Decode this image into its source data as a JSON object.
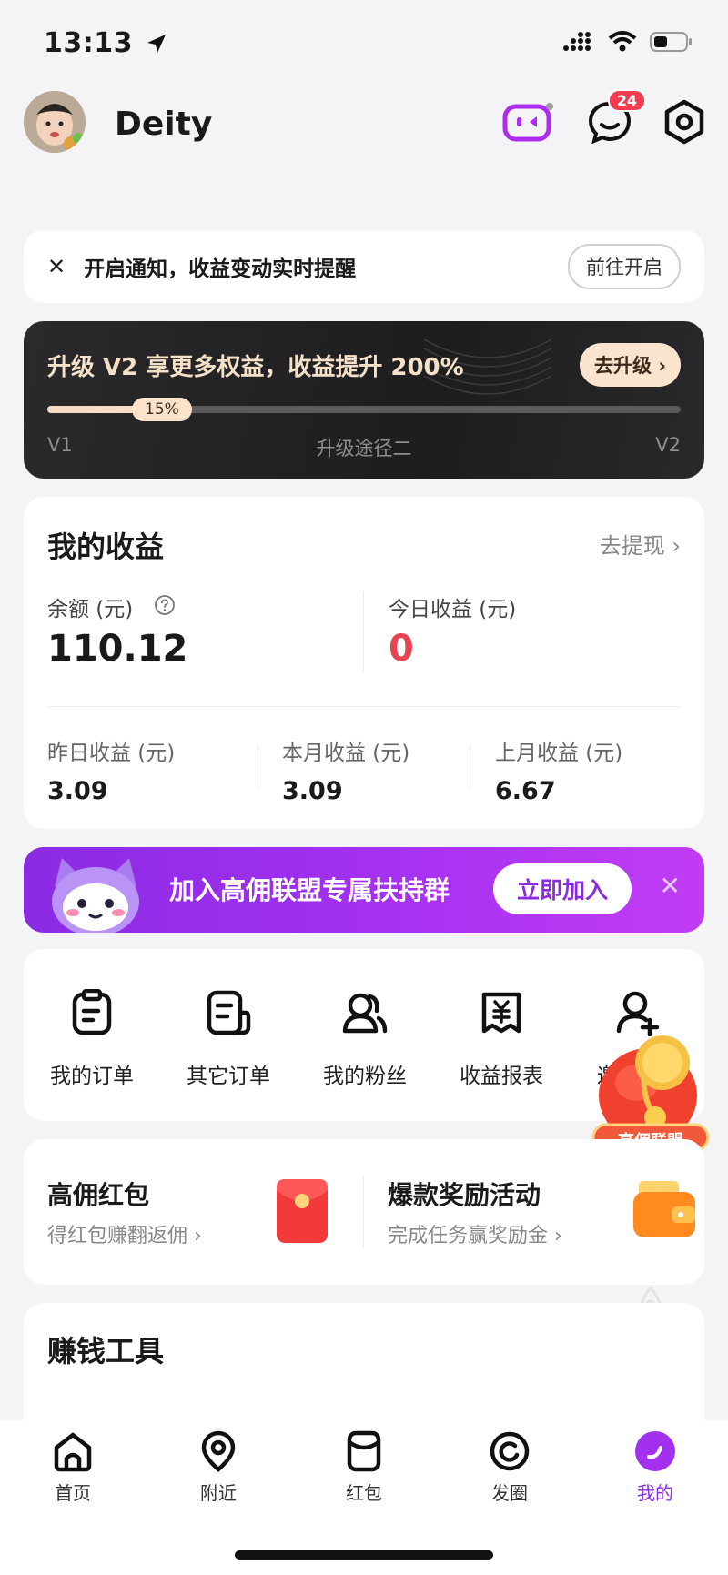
{
  "status_bar": {
    "time": "13:13"
  },
  "header": {
    "username": "Deity",
    "messages_badge": "24"
  },
  "notice": {
    "text": "开启通知，收益变动实时提醒",
    "button": "前往开启"
  },
  "upgrade": {
    "title": "升级 V2 享更多权益，收益提升 200%",
    "button": "去升级",
    "progress_percent": 15,
    "progress_label": "15%",
    "level_from": "V1",
    "level_to": "V2",
    "path_label": "升级途径二"
  },
  "earnings": {
    "title": "我的收益",
    "withdraw": "去提现",
    "balance_label": "余额 (元)",
    "balance_value": "110.12",
    "today_label": "今日收益 (元)",
    "today_value": "0",
    "yesterday_label": "昨日收益 (元)",
    "yesterday_value": "3.09",
    "month_label": "本月收益 (元)",
    "month_value": "3.09",
    "last_month_label": "上月收益 (元)",
    "last_month_value": "6.67"
  },
  "promo": {
    "text": "加入高佣联盟专属扶持群",
    "button": "立即加入"
  },
  "menu": [
    {
      "label": "我的订单",
      "icon": "order-icon"
    },
    {
      "label": "其它订单",
      "icon": "other-order-icon"
    },
    {
      "label": "我的粉丝",
      "icon": "fans-icon"
    },
    {
      "label": "收益报表",
      "icon": "report-icon"
    },
    {
      "label": "邀请",
      "icon": "invite-icon"
    }
  ],
  "floating_badge": "高佣联盟",
  "rewards": [
    {
      "title": "高佣红包",
      "subtitle": "得红包赚翻返佣"
    },
    {
      "title": "爆款奖励活动",
      "subtitle": "完成任务赢奖励金"
    }
  ],
  "tools": {
    "title": "赚钱工具"
  },
  "bottom_nav": [
    {
      "label": "首页",
      "icon": "home-icon"
    },
    {
      "label": "附近",
      "icon": "location-icon"
    },
    {
      "label": "红包",
      "icon": "red-packet-icon"
    },
    {
      "label": "发圈",
      "icon": "moments-icon"
    },
    {
      "label": "我的",
      "icon": "profile-icon",
      "active": true
    }
  ],
  "colors": {
    "accent": "#8a2be2",
    "red": "#f23b4e",
    "gold": "#fbe2cb"
  }
}
